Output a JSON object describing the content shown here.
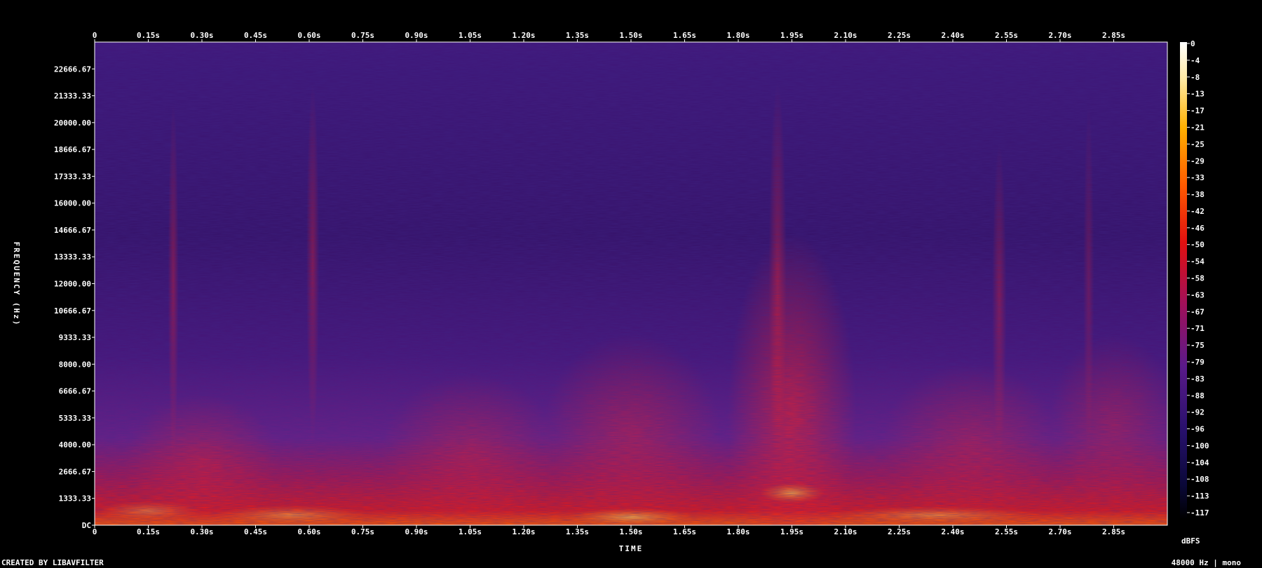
{
  "chart_data": {
    "type": "heatmap",
    "title": "",
    "xlabel": "TIME",
    "ylabel": "FREQUENCY (Hz)",
    "x_ticks": [
      "0",
      "0.15s",
      "0.30s",
      "0.45s",
      "0.60s",
      "0.75s",
      "0.90s",
      "1.05s",
      "1.20s",
      "1.35s",
      "1.50s",
      "1.65s",
      "1.80s",
      "1.95s",
      "2.10s",
      "2.25s",
      "2.40s",
      "2.55s",
      "2.70s",
      "2.85s"
    ],
    "x_tick_values": [
      0,
      0.15,
      0.3,
      0.45,
      0.6,
      0.75,
      0.9,
      1.05,
      1.2,
      1.35,
      1.5,
      1.65,
      1.8,
      1.95,
      2.1,
      2.25,
      2.4,
      2.55,
      2.7,
      2.85
    ],
    "xlim": [
      0,
      3.0
    ],
    "y_ticks": [
      "DC",
      "1333.33",
      "2666.67",
      "4000.00",
      "5333.33",
      "6666.67",
      "8000.00",
      "9333.33",
      "10666.67",
      "12000.00",
      "13333.33",
      "14666.67",
      "16000.00",
      "17333.33",
      "18666.67",
      "20000.00",
      "21333.33",
      "22666.67"
    ],
    "y_tick_values": [
      0,
      1333.33,
      2666.67,
      4000,
      5333.33,
      6666.67,
      8000,
      9333.33,
      10666.67,
      12000,
      13333.33,
      14666.67,
      16000,
      17333.33,
      18666.67,
      20000,
      21333.33,
      22666.67
    ],
    "ylim": [
      0,
      24000
    ],
    "colorbar": {
      "label": "dBFS",
      "ticks": [
        "0",
        "-4",
        "-8",
        "-13",
        "-17",
        "-21",
        "-25",
        "-29",
        "-33",
        "-38",
        "-42",
        "-46",
        "-50",
        "-54",
        "-58",
        "-63",
        "-67",
        "-71",
        "-75",
        "-79",
        "-83",
        "-88",
        "-92",
        "-96",
        "-100",
        "-104",
        "-108",
        "-113",
        "-117"
      ],
      "range": [
        -120,
        0
      ]
    },
    "colors": {
      "low": "#000000",
      "mid_low": "#3a0a6e",
      "mid": "#6b1f8a",
      "mid_high": "#c2102a",
      "high": "#ff6a00",
      "top": "#ffffff"
    }
  },
  "footer": {
    "left": "CREATED BY LIBAVFILTER",
    "right": "48000 Hz | mono"
  }
}
